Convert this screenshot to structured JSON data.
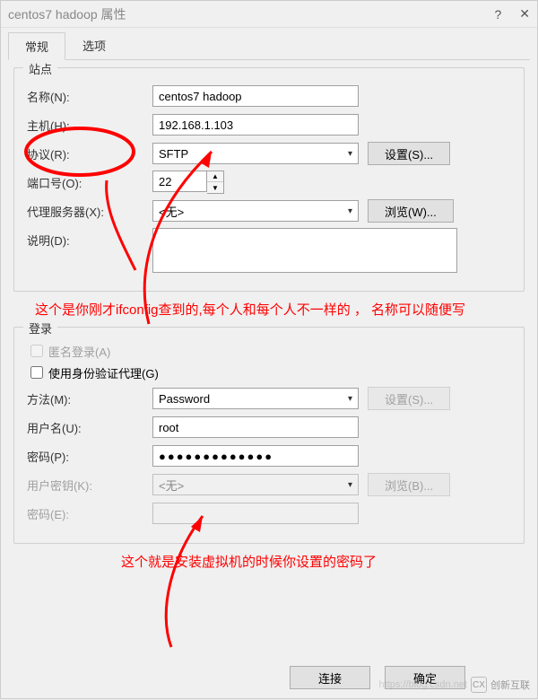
{
  "window": {
    "title": "centos7 hadoop 属性",
    "help_symbol": "?",
    "close_symbol": "✕"
  },
  "tabs": {
    "general": "常规",
    "options": "选项"
  },
  "site_group": {
    "title": "站点",
    "name_label": "名称(N):",
    "name_value": "centos7 hadoop",
    "host_label": "主机(H):",
    "host_value": "192.168.1.103",
    "protocol_label": "协议(R):",
    "protocol_value": "SFTP",
    "settings_btn": "设置(S)...",
    "port_label": "端口号(O):",
    "port_value": "22",
    "proxy_label": "代理服务器(X):",
    "proxy_value": "<无>",
    "browse_btn": "浏览(W)...",
    "desc_label": "说明(D):",
    "desc_value": ""
  },
  "login_group": {
    "title": "登录",
    "anon_label": "匿名登录(A)",
    "use_auth_agent_label": "使用身份验证代理(G)",
    "method_label": "方法(M):",
    "method_value": "Password",
    "method_settings_btn": "设置(S)...",
    "username_label": "用户名(U):",
    "username_value": "root",
    "password_label": "密码(P):",
    "password_display": "●●●●●●●●●●●●●",
    "userkey_label": "用户密钥(K):",
    "userkey_value": "<无>",
    "userkey_browse_btn": "浏览(B)...",
    "passphrase_label": "密码(E):",
    "passphrase_value": ""
  },
  "footer": {
    "connect_btn": "连接",
    "ok_btn": "确定"
  },
  "annotations": {
    "host_note": "这个是你刚才ifconfig查到的,每个人和每个人不一样的 ， 名称可以随便写",
    "password_note": "这个就是安装虚拟机的时候你设置的密码了"
  },
  "watermark": {
    "brand": "创新互联",
    "url": "https://blog.csdn.net"
  }
}
